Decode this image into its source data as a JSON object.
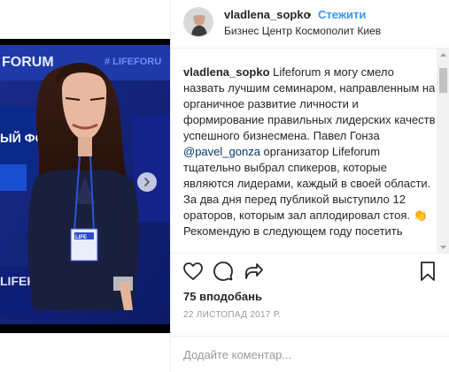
{
  "post": {
    "username": "vladlena_sopko",
    "separator": "•",
    "follow_label": "Стежити",
    "location": "Бизнес Центр Космополит Киев"
  },
  "photo": {
    "banner_text_1": "FORUM",
    "banner_text_2": "# LIFEFORU",
    "banner_text_3": "ЫЙ ФО",
    "banner_text_4": "LIFEFORUM",
    "badge_text": "LIFE"
  },
  "caption": {
    "user": "vladlena_sopko",
    "part1": " Lifeforum я могу смело назвать лучшим семинаром, направленным на органичное развитие личности и формирование правильных лидерских качеств успешного бизнесмена. Павел Гонза ",
    "mention": "@pavel_gonza",
    "part2": " организатор Lifeforum тщательно выбрал спикеров, которые являются лидерами, каждый в своей области. За два дня перед публикой выступило 12 ораторов, которым зал аплодировал стоя. 👏 Рекомендую в следующем году посетить"
  },
  "stats": {
    "likes": "75 вподобань",
    "date": "22 ЛИСТОПАД 2017 Р."
  },
  "comment": {
    "placeholder": "Додайте коментар..."
  },
  "icons": {
    "like": "heart-icon",
    "comment": "comment-bubble-icon",
    "share": "share-icon",
    "save": "bookmark-icon",
    "next": "chevron-right-icon"
  },
  "colors": {
    "link": "#3897f0",
    "mention": "#003569",
    "muted": "#999999",
    "text": "#262626",
    "border": "#efefef"
  }
}
